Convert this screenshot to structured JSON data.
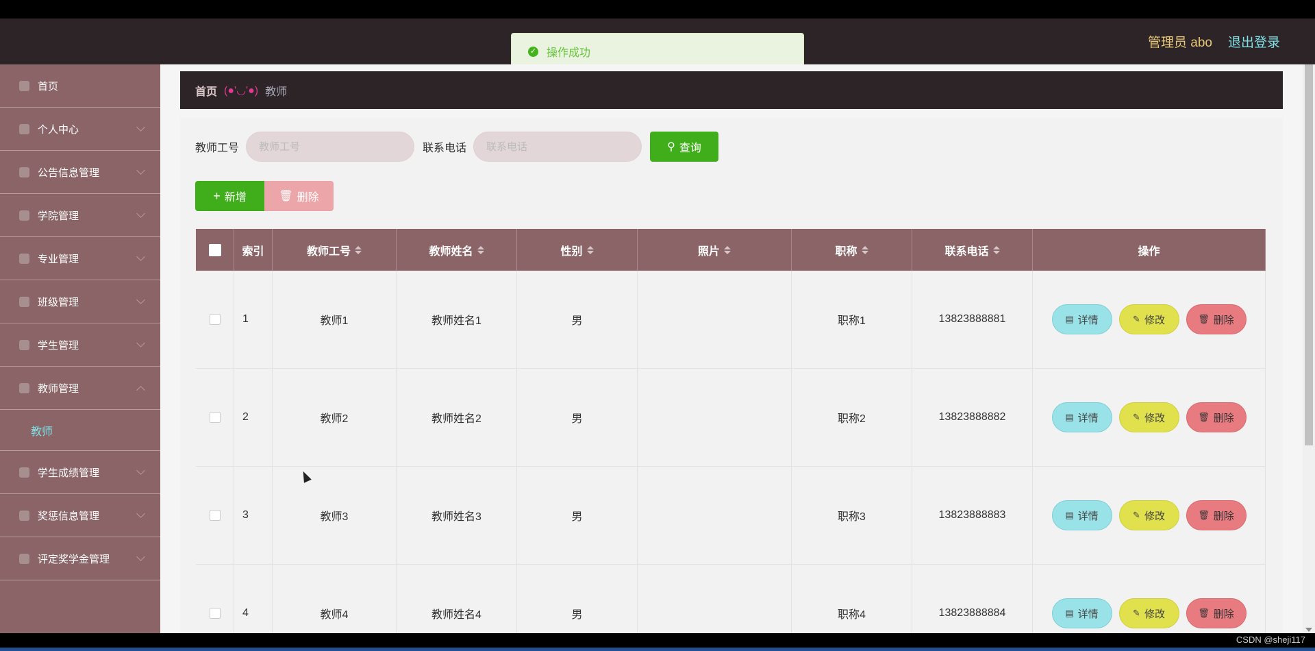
{
  "header": {
    "user_label": "管理员 abo",
    "logout_label": "退出登录"
  },
  "toast": {
    "text": "操作成功"
  },
  "sidebar": {
    "items": [
      {
        "label": "首页",
        "expanded": false
      },
      {
        "label": "个人中心"
      },
      {
        "label": "公告信息管理"
      },
      {
        "label": "学院管理"
      },
      {
        "label": "专业管理"
      },
      {
        "label": "班级管理"
      },
      {
        "label": "学生管理"
      },
      {
        "label": "教师管理",
        "expanded": true
      },
      {
        "label": "学生成绩管理"
      },
      {
        "label": "奖惩信息管理"
      },
      {
        "label": "评定奖学金管理"
      }
    ],
    "sub_item": "教师"
  },
  "breadcrumb": {
    "home": "首页",
    "separator": "(●'◡'●)",
    "current": "教师"
  },
  "search": {
    "teacher_id_label": "教师工号",
    "teacher_id_placeholder": "教师工号",
    "phone_label": "联系电话",
    "phone_placeholder": "联系电话",
    "query_label": "查询"
  },
  "toolbar": {
    "add_label": "新增",
    "delete_label": "删除"
  },
  "table": {
    "columns": [
      "索引",
      "教师工号",
      "教师姓名",
      "性别",
      "照片",
      "职称",
      "联系电话",
      "操作"
    ],
    "rows": [
      {
        "index": "1",
        "teacher_id": "教师1",
        "name": "教师姓名1",
        "gender": "男",
        "photo": "",
        "title": "职称1",
        "phone": "13823888881"
      },
      {
        "index": "2",
        "teacher_id": "教师2",
        "name": "教师姓名2",
        "gender": "男",
        "photo": "",
        "title": "职称2",
        "phone": "13823888882"
      },
      {
        "index": "3",
        "teacher_id": "教师3",
        "name": "教师姓名3",
        "gender": "男",
        "photo": "",
        "title": "职称3",
        "phone": "13823888883"
      },
      {
        "index": "4",
        "teacher_id": "教师4",
        "name": "教师姓名4",
        "gender": "男",
        "photo": "",
        "title": "职称4",
        "phone": "13823888884"
      }
    ],
    "op_detail": "详情",
    "op_edit": "修改",
    "op_delete": "删除"
  },
  "footer": {
    "watermark": "CSDN @sheji117"
  },
  "colors": {
    "header_bg": "#2d2427",
    "sidebar_bg": "#8a6466",
    "accent_green": "#3fae1a",
    "active_text": "#7fe0e6"
  }
}
